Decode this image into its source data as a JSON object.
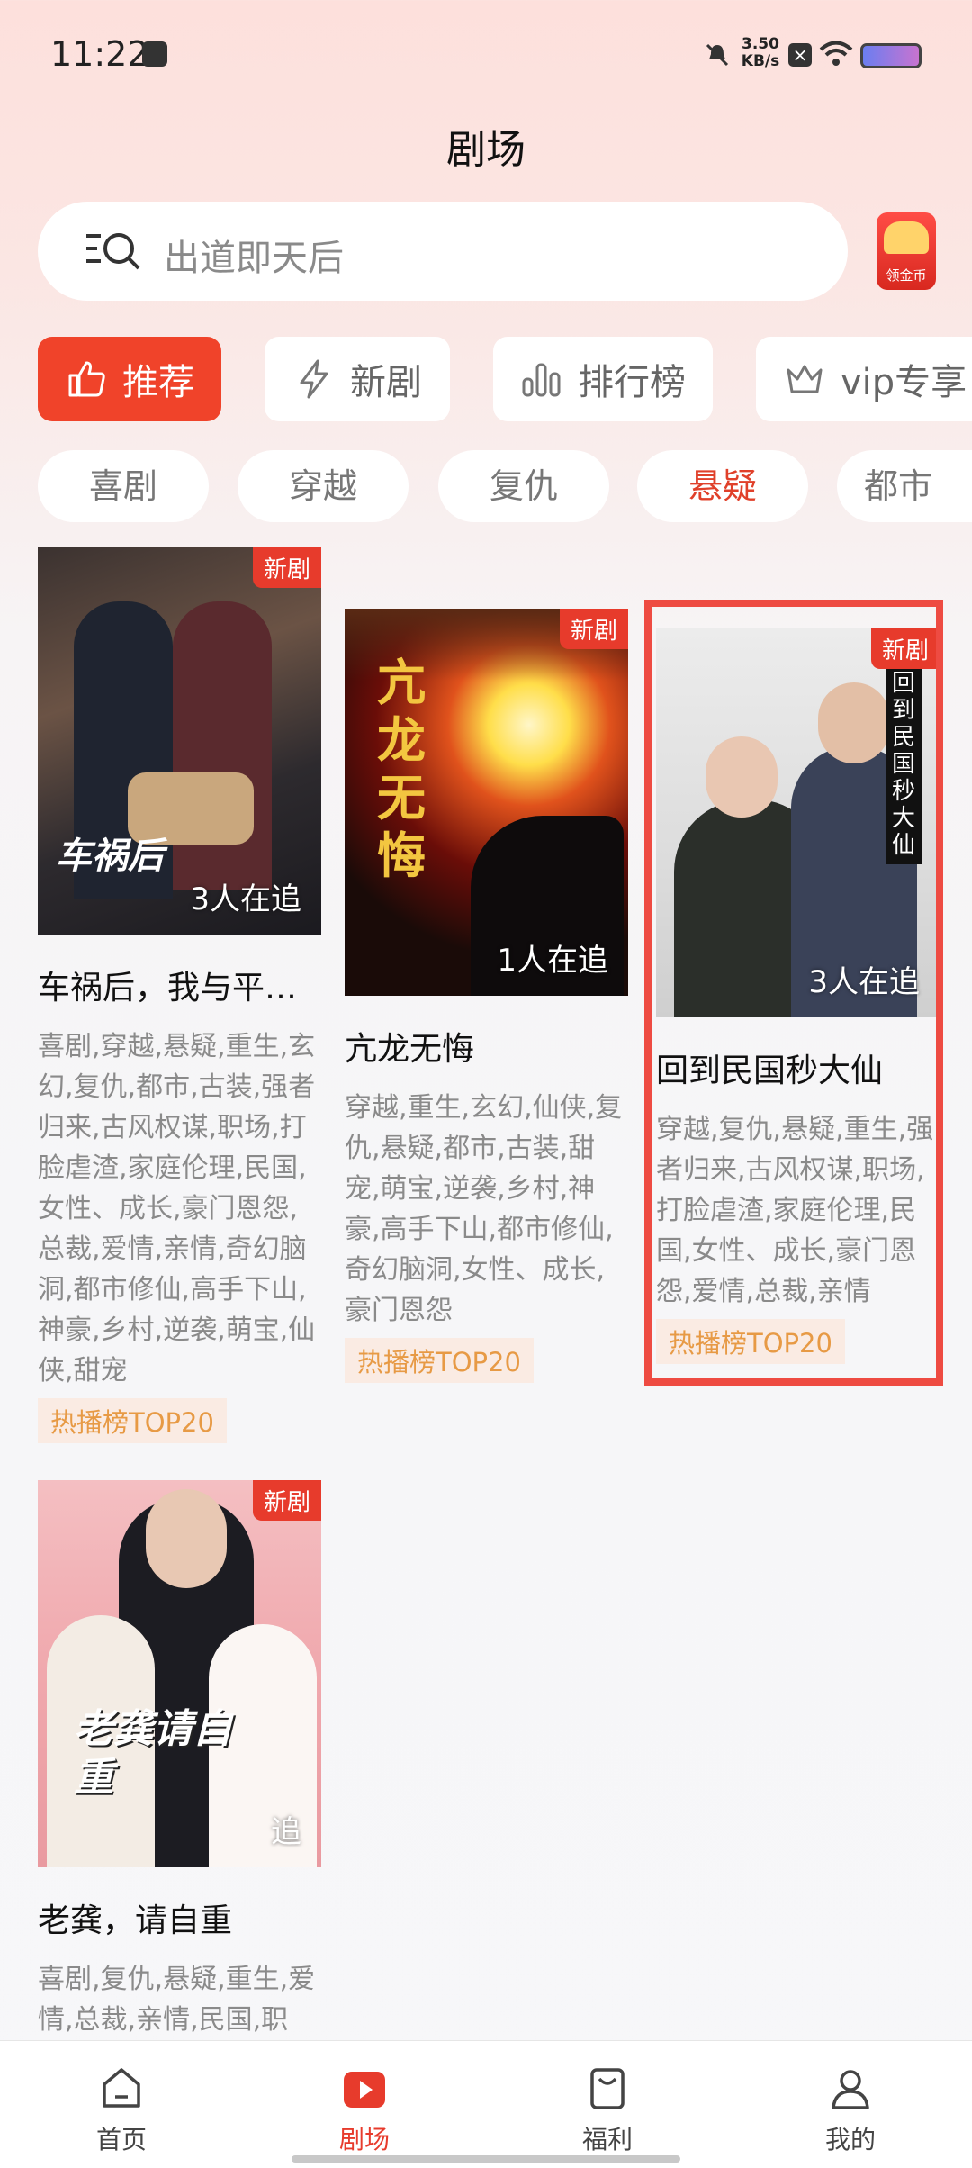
{
  "status_bar": {
    "time": "11:22",
    "speed_value": "3.50",
    "speed_unit": "KB/s"
  },
  "header": {
    "title": "剧场"
  },
  "search": {
    "placeholder": "出道即天后",
    "coin_label": "领金币"
  },
  "category_tabs": [
    {
      "label": "推荐",
      "icon": "thumbs-up-icon",
      "active": true
    },
    {
      "label": "新剧",
      "icon": "lightning-icon",
      "active": false
    },
    {
      "label": "排行榜",
      "icon": "bar-chart-icon",
      "active": false
    },
    {
      "label": "vip专享",
      "icon": "crown-icon",
      "active": false
    }
  ],
  "genre_chips": [
    {
      "label": "喜剧",
      "active": false
    },
    {
      "label": "穿越",
      "active": false
    },
    {
      "label": "复仇",
      "active": false
    },
    {
      "label": "悬疑",
      "active": true
    },
    {
      "label": "都市",
      "active": false
    }
  ],
  "dramas": [
    {
      "title": "车祸后，我与平行世界的自己互换了灵魂",
      "badge": "新剧",
      "followers": "3人在追",
      "poster_text": "车祸后",
      "tags": "喜剧,穿越,悬疑,重生,玄幻,复仇,都市,古装,强者归来,古风权谋,职场,打脸虐渣,家庭伦理,民国,女性、成长,豪门恩怨,总裁,爱情,亲情,奇幻脑洞,都市修仙,高手下山,神豪,乡村,逆袭,萌宝,仙侠,甜宠",
      "rank": "热播榜TOP20"
    },
    {
      "title": "亢龙无悔",
      "badge": "新剧",
      "followers": "1人在追",
      "poster_text": "亢龙无悔",
      "tags": "穿越,重生,玄幻,仙侠,复仇,悬疑,都市,古装,甜宠,萌宝,逆袭,乡村,神豪,高手下山,都市修仙,奇幻脑洞,女性、成长,豪门恩怨",
      "rank": "热播榜TOP20"
    },
    {
      "title": "回到民国秒大仙",
      "badge": "新剧",
      "followers": "3人在追",
      "poster_text": "回到民国秒大仙",
      "tags": "穿越,复仇,悬疑,重生,强者归来,古风权谋,职场,打脸虐渣,家庭伦理,民国,女性、成长,豪门恩怨,爱情,总裁,亲情",
      "rank": "热播榜TOP20"
    },
    {
      "title": "老龚，请自重",
      "badge": "新剧",
      "followers": "追",
      "poster_text": "老龚请自重",
      "tags": "喜剧,复仇,悬疑,重生,爱情,总裁,亲情,民国,职",
      "rank": ""
    }
  ],
  "bottom_nav": [
    {
      "label": "首页",
      "icon": "home-icon",
      "active": false
    },
    {
      "label": "剧场",
      "icon": "play-icon",
      "active": true
    },
    {
      "label": "福利",
      "icon": "bag-icon",
      "active": false
    },
    {
      "label": "我的",
      "icon": "user-icon",
      "active": false
    }
  ],
  "colors": {
    "accent": "#f0432a",
    "rank_text": "#e79a45",
    "highlight": "#ee4b42"
  }
}
